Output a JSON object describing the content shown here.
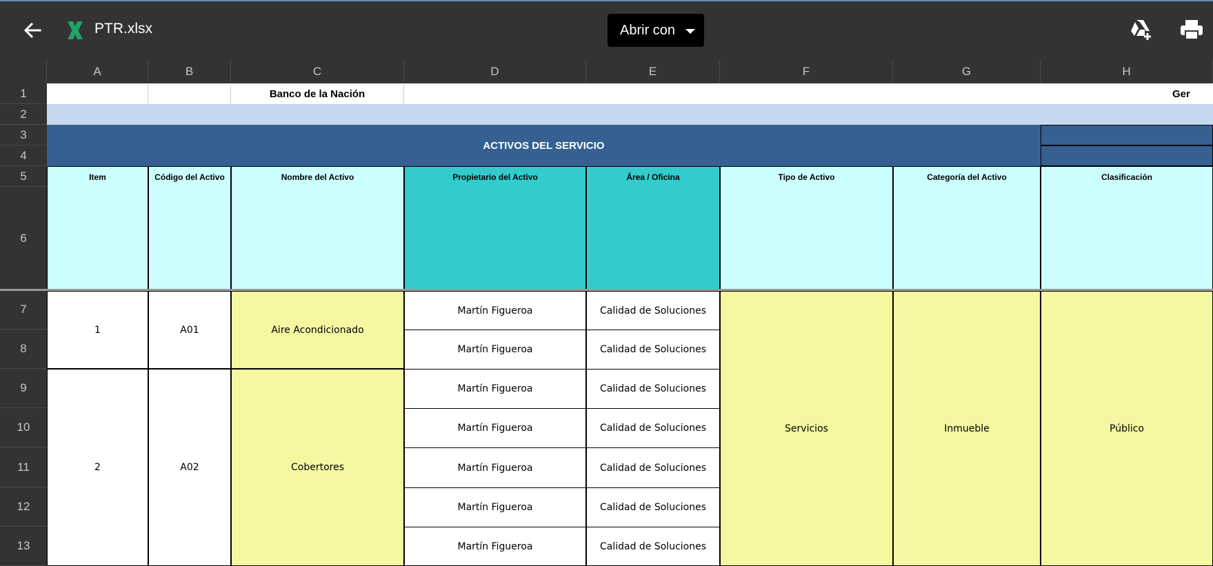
{
  "toolbar": {
    "file_name": "PTR.xlsx",
    "open_with_label": "Abrir con",
    "icons": {
      "back": "arrow-left-icon",
      "file": "excel-icon",
      "drive": "drive-add-icon",
      "print": "print-icon"
    },
    "colors": {
      "excel_green": "#1fa463",
      "bar_bg": "#333333"
    }
  },
  "columns": [
    "A",
    "B",
    "C",
    "D",
    "E",
    "F",
    "G",
    "H"
  ],
  "rows": [
    "1",
    "2",
    "3",
    "4",
    "5",
    "6",
    "7",
    "8",
    "9",
    "10",
    "11",
    "12",
    "13"
  ],
  "sheet": {
    "title_bank": "Banco de la Nación",
    "title_right_partial": "Ger",
    "section_header": "ACTIVOS DEL SERVICIO",
    "headers": {
      "item": "Item",
      "code": "Código del Activo",
      "name": "Nombre del Activo",
      "owner": "Propietario del Activo",
      "area": "Área / Oficina",
      "type": "Tipo de Activo",
      "category": "Categoría del Activo",
      "classification": "Clasificación"
    },
    "assets": [
      {
        "item": "1",
        "code": "A01",
        "name": "Aire Acondicionado"
      },
      {
        "item": "2",
        "code": "A02",
        "name": "Cobertores"
      }
    ],
    "owners": [
      "Martín Figueroa",
      "Martín Figueroa",
      "Martín Figueroa",
      "Martín Figueroa",
      "Martín Figueroa",
      "Martín Figueroa",
      "Martín Figueroa"
    ],
    "areas": [
      "Calidad de Soluciones",
      "Calidad de Soluciones",
      "Calidad de Soluciones",
      "Calidad de Soluciones",
      "Calidad de Soluciones",
      "Calidad de Soluciones",
      "Calidad de Soluciones"
    ],
    "type_value": "Servicios",
    "category_value": "Inmueble",
    "classification_value": "Público",
    "colors": {
      "light_blue_band": "#c6d9f0",
      "dark_blue_header": "#366092",
      "cyan_header": "#ccffff",
      "teal_header": "#33cccc",
      "yellow": "#f5f7a1"
    }
  }
}
